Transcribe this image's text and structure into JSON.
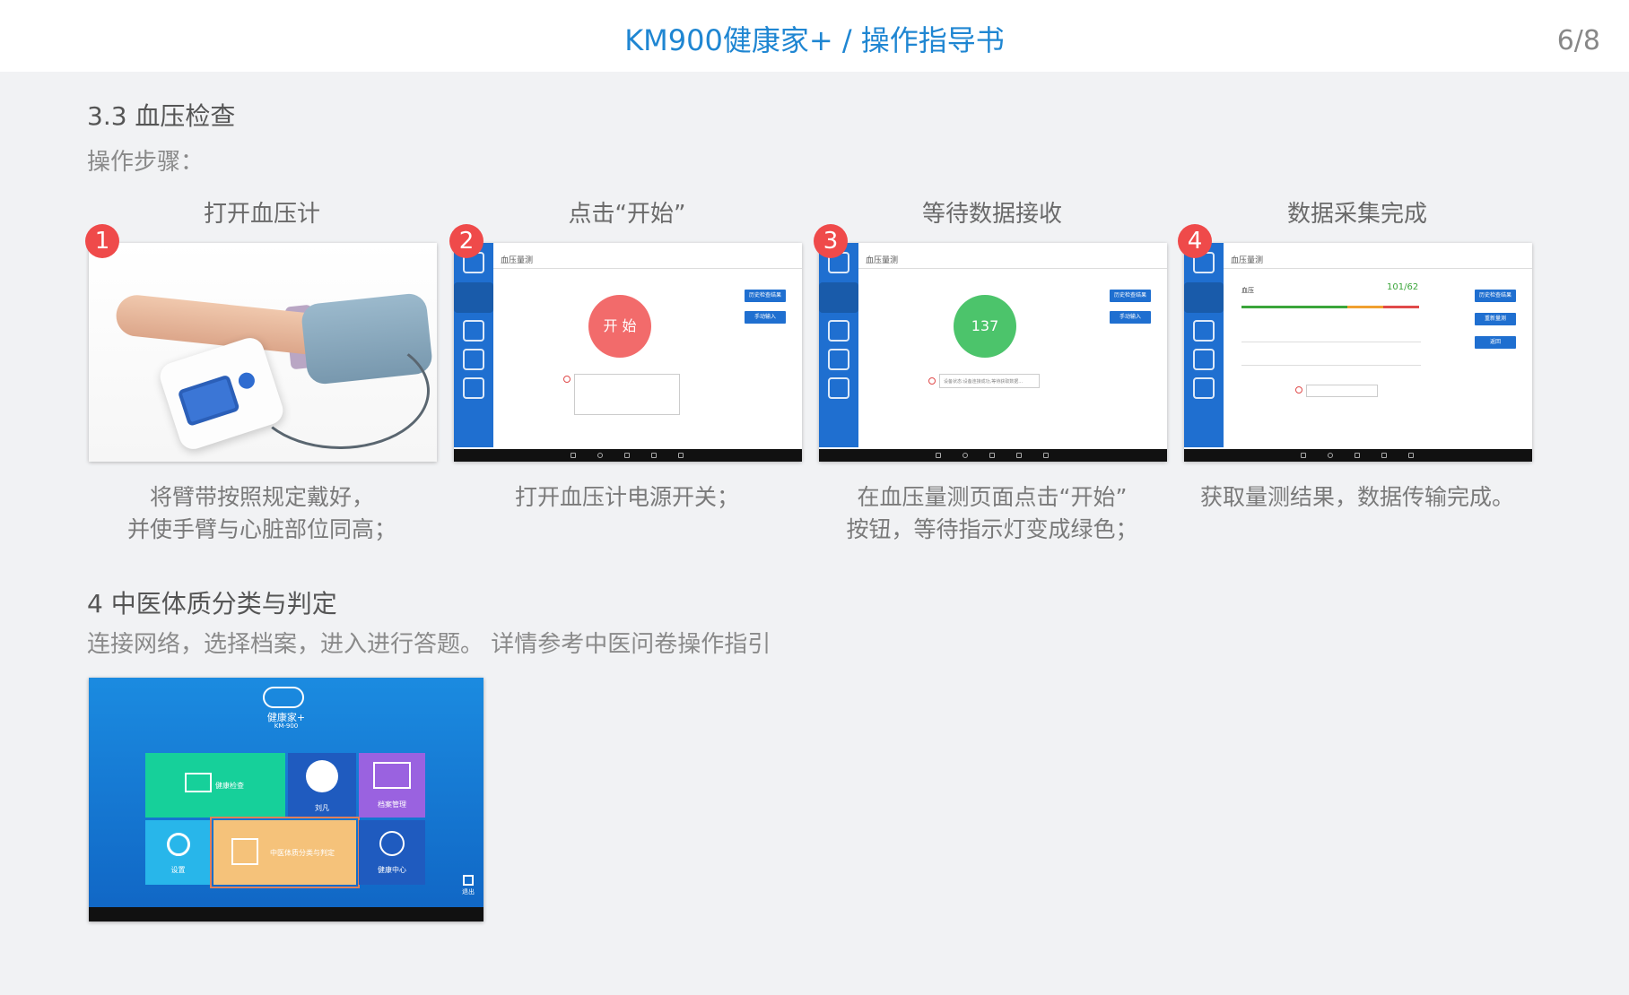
{
  "header": {
    "title": "KM900健康家+ / 操作指导书",
    "page": "6/8"
  },
  "section_bp": {
    "title": "3.3 血压检查",
    "subtitle": "操作步骤："
  },
  "steps": [
    {
      "badge": "1",
      "title": "打开血压计",
      "desc_lines": [
        "将臂带按照规定戴好，",
        "并使手臂与心脏部位同高；"
      ]
    },
    {
      "badge": "2",
      "title": "点击“开始”",
      "desc_lines": [
        "打开血压计电源开关；",
        ""
      ]
    },
    {
      "badge": "3",
      "title": "等待数据接收",
      "desc_lines": [
        "在血压量测页面点击“开始”",
        "按钮，等待指示灯变成绿色；"
      ]
    },
    {
      "badge": "4",
      "title": "数据采集完成",
      "desc_lines": [
        "获取量测结果，数据传输完成。",
        ""
      ]
    }
  ],
  "app": {
    "page_title": "血压量测",
    "btn_history": "历史检查结果",
    "btn_manual": "手动输入",
    "btn_rerun": "重新量测",
    "btn_back": "返回",
    "start_label": "开 始",
    "reading": "137",
    "result_label": "血压",
    "result_value": "101/62",
    "status_text": "设备状态:设备连接成功,等待获取数据..."
  },
  "section_tcm": {
    "title": "4 中医体质分类与判定",
    "subtitle": "连接网络，选择档案，进入进行答题。 详情参考中医问卷操作指引"
  },
  "menu": {
    "brand": "健康家+",
    "model": "KM-900",
    "tiles": {
      "health_check": "健康检查",
      "user": "刘凡",
      "records": "档案管理",
      "settings": "设置",
      "tcm": "中医体质分类与判定",
      "health_center": "健康中心"
    },
    "exit": "退出"
  },
  "colors": {
    "accent": "#1f86d2",
    "badge": "#ef4a4a",
    "start_red": "#f26b6b",
    "ok_green": "#4cc46b",
    "app_blue": "#1f6fd0"
  }
}
